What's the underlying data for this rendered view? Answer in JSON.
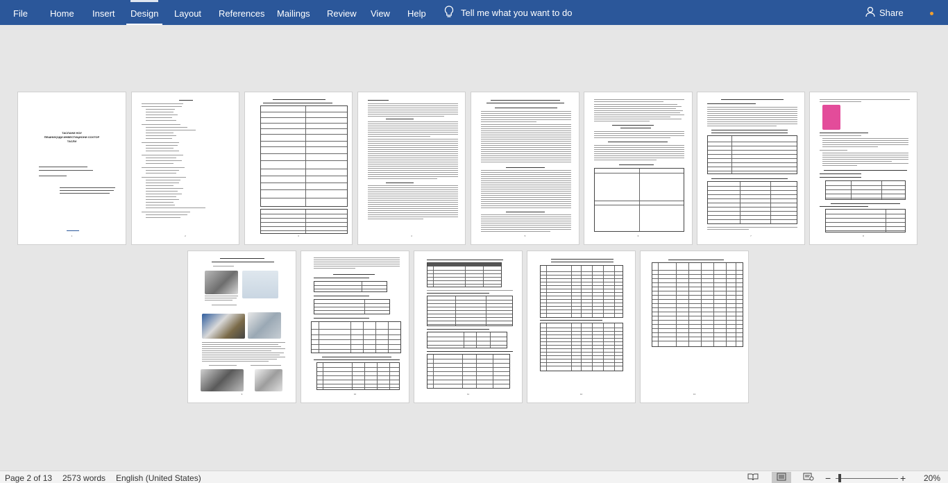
{
  "ribbon": {
    "tabs": [
      "File",
      "Home",
      "Insert",
      "Design",
      "Layout",
      "References",
      "Mailings",
      "Review",
      "View",
      "Help"
    ],
    "active_tab": "Design",
    "tell_me": "Tell me what you want to do",
    "share": "Share"
  },
  "document": {
    "cover_title_line1": "ТАСЛАНИ НОУ",
    "cover_title_line2": "ПЕШНИҲОДИ ИНВЕСТИЦИОНИ СОХТОР",
    "cover_title_line3": "ТАСЛИ",
    "rows": [
      {
        "pages": [
          "1",
          "2",
          "3",
          "4",
          "5",
          "6",
          "7",
          "8"
        ]
      },
      {
        "pages": [
          "9",
          "10",
          "11",
          "12",
          "13"
        ]
      }
    ]
  },
  "status_bar": {
    "page": "Page 2 of 13",
    "words": "2573 words",
    "language": "English (United States)",
    "zoom": "20%",
    "zoom_minus": "−",
    "zoom_plus": "+"
  },
  "colors": {
    "ribbon": "#2b579a",
    "canvas": "#e6e6e6",
    "status_bar": "#f3f3f3"
  }
}
